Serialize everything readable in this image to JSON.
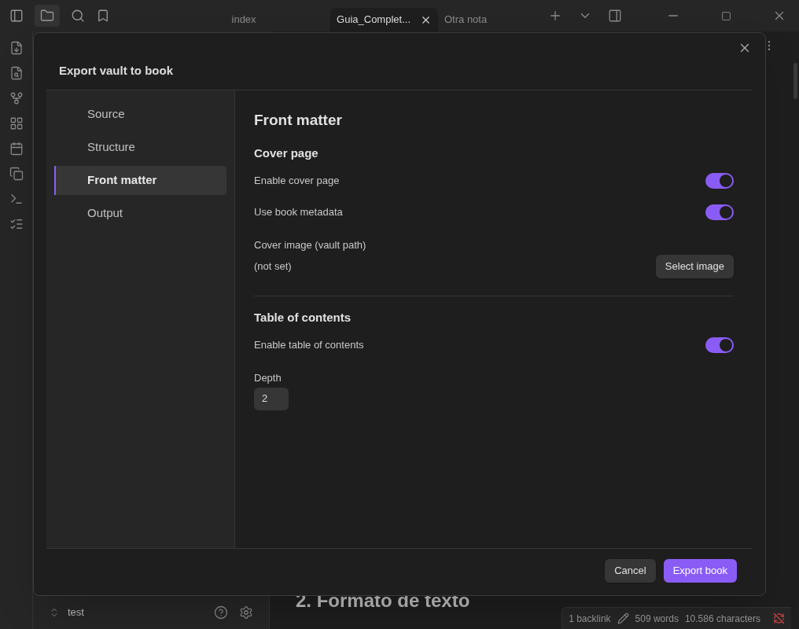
{
  "tabs": [
    {
      "label": "index",
      "selected": false
    },
    {
      "label": "Guia_Complet...",
      "selected": true
    },
    {
      "label": "Otra nota",
      "selected": false
    }
  ],
  "dialog": {
    "title": "Export vault to book",
    "nav": [
      {
        "label": "Source",
        "selected": false
      },
      {
        "label": "Structure",
        "selected": false
      },
      {
        "label": "Front matter",
        "selected": true
      },
      {
        "label": "Output",
        "selected": false
      }
    ],
    "page_title": "Front matter",
    "sections": [
      {
        "heading": "Cover page",
        "settings": [
          {
            "kind": "toggle",
            "label": "Enable cover page",
            "on": true
          },
          {
            "kind": "toggle",
            "label": "Use book metadata",
            "on": true
          },
          {
            "kind": "picker",
            "label": "Cover image (vault path)",
            "value": "(not set)",
            "button": "Select image"
          }
        ]
      },
      {
        "heading": "Table of contents",
        "settings": [
          {
            "kind": "toggle",
            "label": "Enable table of contents",
            "on": true
          },
          {
            "kind": "number",
            "label": "Depth",
            "value": "2"
          }
        ]
      }
    ],
    "buttons": [
      {
        "label": "Cancel",
        "kind": "secondary"
      },
      {
        "label": "Export book",
        "kind": "primary"
      }
    ]
  },
  "vault": {
    "name": "test"
  },
  "note": {
    "heading": "2. Formato de texto"
  },
  "status_bar": [
    "1 backlink",
    "509 words",
    "10.586 characters"
  ]
}
